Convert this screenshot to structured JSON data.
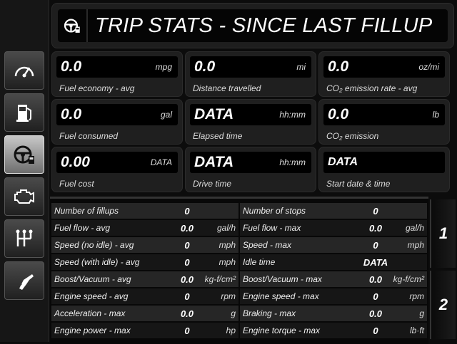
{
  "sidebar": {
    "items": [
      {
        "icon": "gauge-icon"
      },
      {
        "icon": "fuel-pump-icon"
      },
      {
        "icon": "steering-wheel-fuel-icon",
        "active": true
      },
      {
        "icon": "engine-icon"
      },
      {
        "icon": "gear-shifter-icon"
      },
      {
        "icon": "fuel-nozzle-icon"
      }
    ]
  },
  "header": {
    "title": "TRIP STATS - SINCE LAST FILLUP",
    "icon": "steering-wheel-fuel-icon"
  },
  "cards": [
    {
      "value": "0.0",
      "unit": "mpg",
      "label": "Fuel economy - avg"
    },
    {
      "value": "0.0",
      "unit": "mi",
      "label": "Distance travelled"
    },
    {
      "value": "0.0",
      "unit": "oz/mi",
      "label": "CO₂  emission rate - avg"
    },
    {
      "value": "0.0",
      "unit": "gal",
      "label": "Fuel consumed"
    },
    {
      "value": "DATA",
      "unit": "hh:mm",
      "label": "Elapsed time"
    },
    {
      "value": "0.0",
      "unit": "lb",
      "label": "CO₂  emission"
    },
    {
      "value": "0.00",
      "unit": "DATA",
      "label": "Fuel cost"
    },
    {
      "value": "DATA",
      "unit": "hh:mm",
      "label": "Drive time"
    },
    {
      "value": "DATA",
      "unit": "",
      "label": "Start date & time"
    }
  ],
  "table": {
    "left": [
      {
        "name": "Number of fillups",
        "value": "0",
        "unit": ""
      },
      {
        "name": "Fuel flow - avg",
        "value": "0.0",
        "unit": "gal/h"
      },
      {
        "name": "Speed (no idle) - avg",
        "value": "0",
        "unit": "mph"
      },
      {
        "name": "Speed (with idle) - avg",
        "value": "0",
        "unit": "mph"
      },
      {
        "name": "Boost/Vacuum - avg",
        "value": "0.0",
        "unit": "kg-f/cm²"
      },
      {
        "name": "Engine speed - avg",
        "value": "0",
        "unit": "rpm"
      },
      {
        "name": "Acceleration - max",
        "value": "0.0",
        "unit": "g"
      },
      {
        "name": "Engine power - max",
        "value": "0",
        "unit": "hp"
      }
    ],
    "right": [
      {
        "name": "Number of stops",
        "value": "0",
        "unit": ""
      },
      {
        "name": "Fuel flow - max",
        "value": "0.0",
        "unit": "gal/h"
      },
      {
        "name": "Speed - max",
        "value": "0",
        "unit": "mph"
      },
      {
        "name": "Idle time",
        "value": "DATA",
        "unit": ""
      },
      {
        "name": "Boost/Vacuum - max",
        "value": "0.0",
        "unit": "kg-f/cm²"
      },
      {
        "name": "Engine speed - max",
        "value": "0",
        "unit": "rpm"
      },
      {
        "name": "Braking - max",
        "value": "0.0",
        "unit": "g"
      },
      {
        "name": "Engine torque - max",
        "value": "0",
        "unit": "lb·ft"
      }
    ]
  },
  "pages": [
    "1",
    "2"
  ]
}
